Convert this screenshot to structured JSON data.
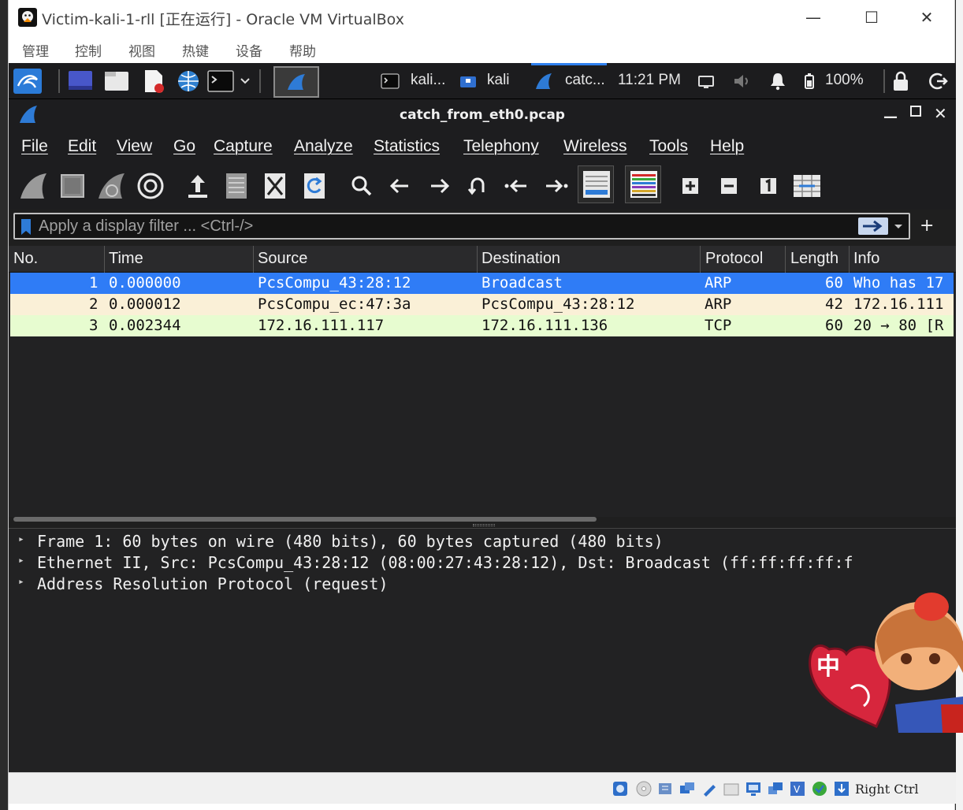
{
  "vbox": {
    "title": "Victim-kali-1-rll [正在运行] - Oracle VM VirtualBox",
    "menu": [
      "管理",
      "控制",
      "视图",
      "热键",
      "设备",
      "帮助"
    ],
    "status_host_key": "Right Ctrl"
  },
  "panel": {
    "tasks": [
      {
        "label": "kali...",
        "icon": "terminal-icon"
      },
      {
        "label": "kali",
        "icon": "folder-icon"
      },
      {
        "label": "catc...",
        "icon": "wireshark-icon"
      }
    ],
    "clock": "11:21 PM",
    "battery": "100%"
  },
  "wireshark": {
    "title": "catch_from_eth0.pcap",
    "menu": [
      "File",
      "Edit",
      "View",
      "Go",
      "Capture",
      "Analyze",
      "Statistics",
      "Telephony",
      "Wireless",
      "Tools",
      "Help"
    ],
    "filter_placeholder": "Apply a display filter ... <Ctrl-/>",
    "columns": [
      "No.",
      "Time",
      "Source",
      "Destination",
      "Protocol",
      "Length",
      "Info"
    ],
    "packets": [
      {
        "no": "1",
        "time": "0.000000",
        "src": "PcsCompu_43:28:12",
        "dst": "Broadcast",
        "proto": "ARP",
        "len": "60",
        "info": "Who has 17"
      },
      {
        "no": "2",
        "time": "0.000012",
        "src": "PcsCompu_ec:47:3a",
        "dst": "PcsCompu_43:28:12",
        "proto": "ARP",
        "len": "42",
        "info": "172.16.111"
      },
      {
        "no": "3",
        "time": "0.002344",
        "src": "172.16.111.117",
        "dst": "172.16.111.136",
        "proto": "TCP",
        "len": "60",
        "info": "20 → 80 [R"
      }
    ],
    "details": [
      "Frame 1: 60 bytes on wire (480 bits), 60 bytes captured (480 bits)",
      "Ethernet II, Src: PcsCompu_43:28:12 (08:00:27:43:28:12), Dst: Broadcast (ff:ff:ff:ff:f",
      "Address Resolution Protocol (request)"
    ]
  },
  "overlay_badge": "中",
  "colors": {
    "selected_row": "#2f7cf6",
    "arp_row": "#faf0d7",
    "tcp_row": "#e7fcd0"
  }
}
